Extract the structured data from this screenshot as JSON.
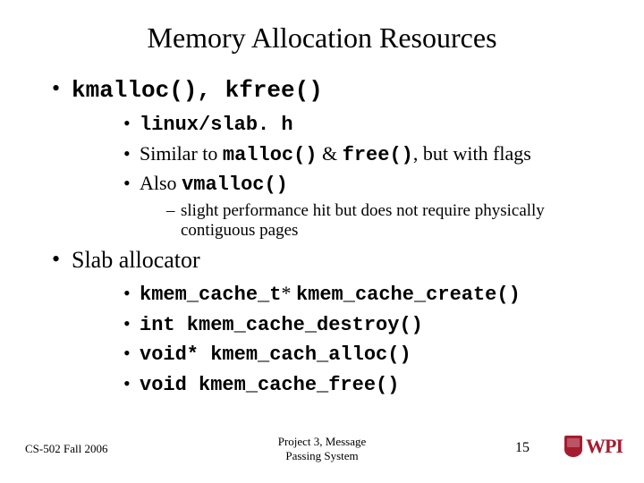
{
  "title": "Memory Allocation Resources",
  "bullets": {
    "item1": {
      "code": "kmalloc(), kfree()",
      "sub1": "linux/slab. h",
      "sub2_pre": "Similar to ",
      "sub2_code1": "malloc()",
      "sub2_mid": " & ",
      "sub2_code2": "free()",
      "sub2_post": ", but with flags",
      "sub3_pre": "Also ",
      "sub3_code": "vmalloc()",
      "sub3_subnote": "slight performance hit but does not require physically contiguous pages"
    },
    "item2": {
      "label": "Slab allocator",
      "sub1_code1": "kmem_cache_t",
      "sub1_star": "* ",
      "sub1_code2": "kmem_cache_create()",
      "sub2_code": "int kmem_cache_destroy()",
      "sub3_code": "void* kmem_cach_alloc()",
      "sub4_code": "void kmem_cache_free()"
    }
  },
  "footer": {
    "left": "CS-502 Fall 2006",
    "center_line1": "Project 3, Message",
    "center_line2": "Passing System",
    "page": "15",
    "logo_text": "WPI"
  }
}
